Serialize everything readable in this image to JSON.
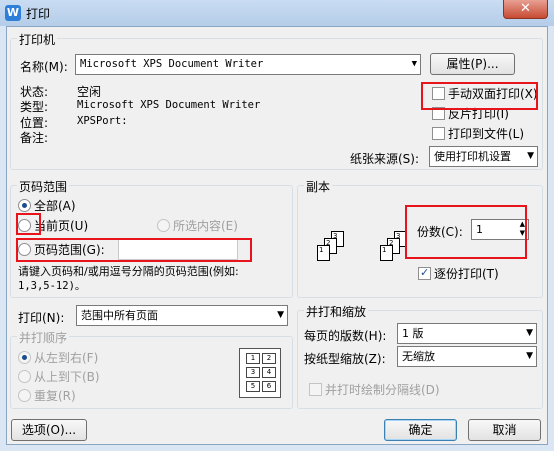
{
  "window": {
    "title": "打印",
    "app_icon_letter": "W",
    "close_symbol": "✕"
  },
  "printer": {
    "group_label": "打印机",
    "name_label": "名称(M):",
    "name_value": "Microsoft XPS Document Writer",
    "properties_button": "属性(P)...",
    "status_label": "状态:",
    "status_value": "空闲",
    "type_label": "类型:",
    "type_value": "Microsoft XPS Document Writer",
    "location_label": "位置:",
    "location_value": "XPSPort:",
    "comment_label": "备注:",
    "comment_value": "",
    "manual_duplex": "手动双面打印(X)",
    "reverse_print": "反片打印(I)",
    "print_to_file": "打印到文件(L)",
    "paper_source_label": "纸张来源(S):",
    "paper_source_value": "使用打印机设置"
  },
  "page_range": {
    "group_label": "页码范围",
    "all": "全部(A)",
    "current_page": "当前页(U)",
    "selection": "所选内容(E)",
    "pages": "页码范围(G):",
    "pages_value": "",
    "hint_line1": "请键入页码和/或用逗号分隔的页码范围(例如:",
    "hint_line2": "1,3,5-12)。"
  },
  "copies": {
    "group_label": "副本",
    "copies_label": "份数(C):",
    "copies_value": "1",
    "collate": "逐份打印(T)",
    "page_digits": [
      "1",
      "2",
      "3"
    ]
  },
  "print_what": {
    "label": "打印(N):",
    "value": "范围中所有页面"
  },
  "merge_order": {
    "group_label": "并打顺序",
    "left_to_right": "从左到右(F)",
    "top_to_bottom": "从上到下(B)",
    "repeat": "重复(R)",
    "grid_numbers": [
      "1",
      "2",
      "3",
      "4",
      "5",
      "6"
    ]
  },
  "zoom": {
    "group_label": "并打和缩放",
    "pages_per_sheet_label": "每页的版数(H):",
    "pages_per_sheet_value": "1 版",
    "scale_label": "按纸型缩放(Z):",
    "scale_value": "无缩放",
    "draw_separator": "并打时绘制分隔线(D)"
  },
  "footer": {
    "options_button": "选项(O)...",
    "ok_button": "确定",
    "cancel_button": "取消"
  },
  "colors": {
    "highlight": "#e8141c",
    "title_bar": "#b5cde9",
    "close_button": "#c74b33"
  }
}
